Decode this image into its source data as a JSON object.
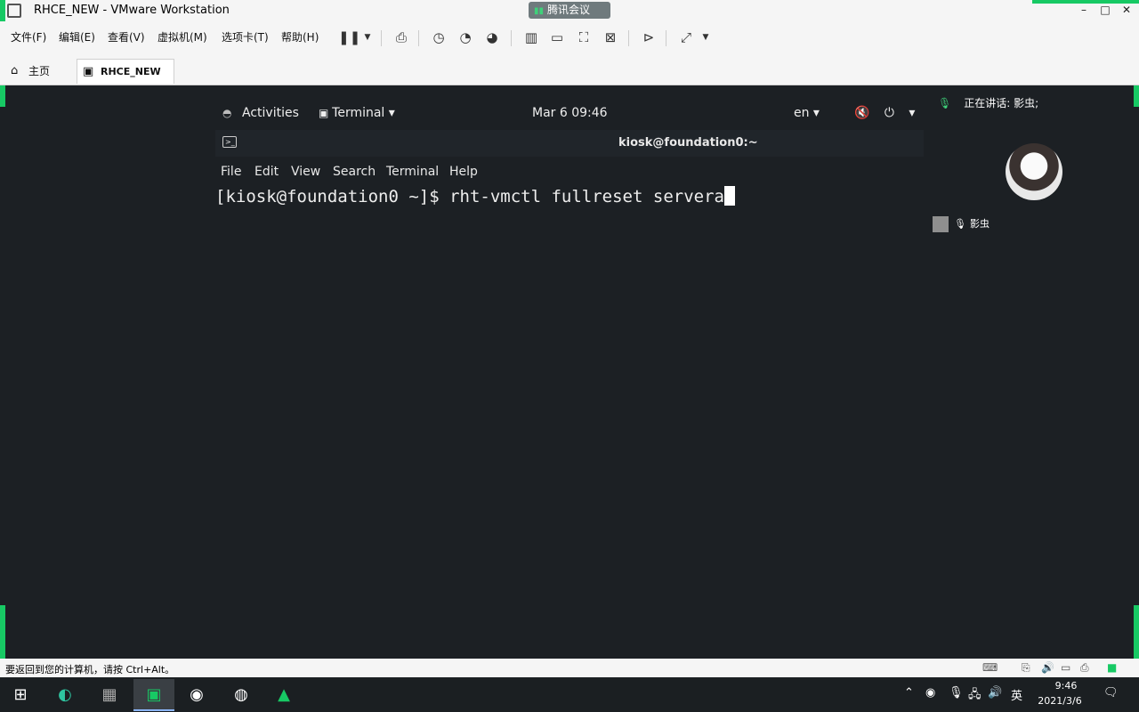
{
  "window": {
    "title": "RHCE_NEW - VMware Workstation",
    "meeting_badge": "腾讯会议",
    "controls": {
      "minimize": "–",
      "maximize": "□",
      "close": "✕"
    }
  },
  "menu": {
    "items": [
      "文件(F)",
      "编辑(E)",
      "查看(V)",
      "虚拟机(M)",
      "选项卡(T)",
      "帮助(H)"
    ]
  },
  "toolbar": {
    "icons": [
      "pause-icon",
      "send-keys-icon",
      "snapshot-icon",
      "revert-snapshot-icon",
      "snapshot-manager-icon",
      "library-icon",
      "normal-view-icon",
      "fullscreen-icon",
      "unity-icon",
      "console-icon",
      "stretch-icon"
    ]
  },
  "tabs": [
    {
      "label": "主页",
      "icon": "home-icon"
    },
    {
      "label": "RHCE_NEW",
      "icon": "vm-icon"
    }
  ],
  "gnome": {
    "activities": "Activities",
    "app_menu": "Terminal ▾",
    "clock": "Mar 6  09:46",
    "lang": "en ▾",
    "system": "🔇 ⏻ ▾"
  },
  "terminal": {
    "title": "kiosk@foundation0:~",
    "menu": [
      "File",
      "Edit",
      "View",
      "Search",
      "Terminal",
      "Help"
    ],
    "prompt_line": "[kiosk@foundation0 ~]$ rht-vmctl fullreset servera"
  },
  "meeting": {
    "speaking": "正在讲话: 影虫;",
    "participant": "影虫"
  },
  "statusbar": {
    "message": "要返回到您的计算机，请按 Ctrl+Alt。"
  },
  "taskbar": {
    "time": "9:46",
    "date": "2021/3/6",
    "ime": "英"
  }
}
